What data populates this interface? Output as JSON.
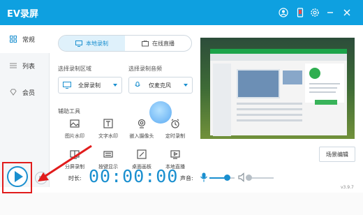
{
  "app": {
    "title": "EV录屏",
    "version": "v3.9.7"
  },
  "sidebar": {
    "items": [
      {
        "label": "常规",
        "icon": "grid-icon",
        "active": true
      },
      {
        "label": "列表",
        "icon": "list-icon",
        "active": false
      },
      {
        "label": "会员",
        "icon": "diamond-icon",
        "active": false
      }
    ]
  },
  "mode_tabs": [
    {
      "label": "本地录制",
      "icon": "monitor-icon",
      "active": true
    },
    {
      "label": "在线直播",
      "icon": "tv-icon",
      "active": false
    }
  ],
  "record_area": {
    "label": "选择录制区域",
    "value": "全屏录制"
  },
  "audio_select": {
    "label": "选择录制音频",
    "value": "仅麦克风"
  },
  "tools": {
    "label": "辅助工具",
    "items": [
      {
        "label": "图片水印",
        "icon": "image-icon"
      },
      {
        "label": "文字水印",
        "icon": "text-icon"
      },
      {
        "label": "嵌入摄像头",
        "icon": "camera-icon"
      },
      {
        "label": "定时录制",
        "icon": "alarm-icon"
      },
      {
        "label": "分屏录制",
        "icon": "split-screen-icon"
      },
      {
        "label": "按键显示",
        "icon": "keyboard-icon"
      },
      {
        "label": "桌面画板",
        "icon": "paint-icon"
      },
      {
        "label": "本地直播",
        "icon": "broadcast-icon"
      }
    ]
  },
  "scene_button": "场景编辑",
  "controls": {
    "timer_label": "时长:",
    "timer_value": "00:00:00",
    "sound_label": "声音:",
    "mic_level": 0.7,
    "speaker_level": 0.0
  },
  "colors": {
    "accent": "#1a8fcf",
    "titlebar": "#0ea0e0",
    "highlight": "#e11c1c"
  }
}
